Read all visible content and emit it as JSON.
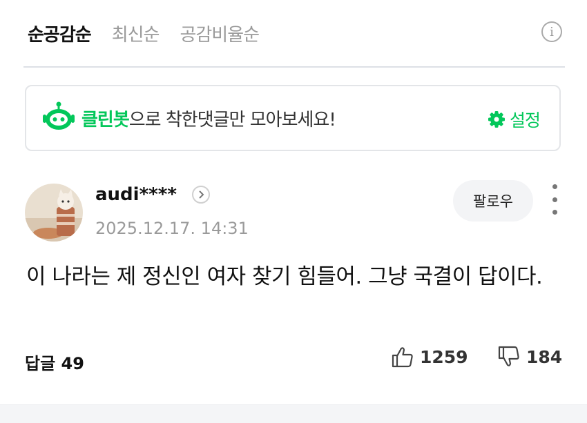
{
  "sort_tabs": [
    {
      "label": "순공감순",
      "active": true
    },
    {
      "label": "최신순",
      "active": false
    },
    {
      "label": "공감비율순",
      "active": false
    }
  ],
  "info_icon": "i",
  "cleanbot": {
    "brand": "클린봇",
    "message": "으로 착한댓글만 모아보세요!",
    "settings_label": "설정",
    "accent": "#03c75a"
  },
  "comment": {
    "username": "audi****",
    "date": "2025.12.17. 14:31",
    "follow_label": "팔로우",
    "text": "이 나라는 제 정신인 여자 찾기 힘들어. 그냥 국결이 답이다.",
    "reply_label": "답글",
    "reply_count": "49",
    "likes": "1259",
    "dislikes": "184"
  },
  "icons": {
    "info": "info-icon",
    "bot": "cleanbot-robot-icon",
    "settings": "gear-icon",
    "chevron": "chevron-right-icon",
    "more": "more-vertical-icon",
    "like": "thumbs-up-icon",
    "dislike": "thumbs-down-icon"
  }
}
